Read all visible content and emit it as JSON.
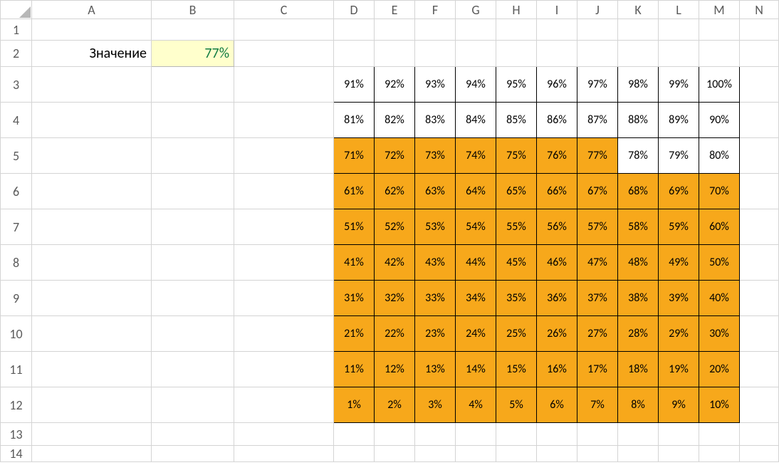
{
  "columns": [
    "A",
    "B",
    "C",
    "D",
    "E",
    "F",
    "G",
    "H",
    "I",
    "J",
    "K",
    "L",
    "M",
    "N"
  ],
  "rows": [
    "1",
    "2",
    "3",
    "4",
    "5",
    "6",
    "7",
    "8",
    "9",
    "10",
    "11",
    "12",
    "13",
    "14"
  ],
  "label": "Значение",
  "value": "77%",
  "threshold_pct": 77,
  "chart_data": {
    "type": "table",
    "title": "Percent grid with highlight ≤ value",
    "rows": [
      [
        "91%",
        "92%",
        "93%",
        "94%",
        "95%",
        "96%",
        "97%",
        "98%",
        "99%",
        "100%"
      ],
      [
        "81%",
        "82%",
        "83%",
        "84%",
        "85%",
        "86%",
        "87%",
        "88%",
        "89%",
        "90%"
      ],
      [
        "71%",
        "72%",
        "73%",
        "74%",
        "75%",
        "76%",
        "77%",
        "78%",
        "79%",
        "80%"
      ],
      [
        "61%",
        "62%",
        "63%",
        "64%",
        "65%",
        "66%",
        "67%",
        "68%",
        "69%",
        "70%"
      ],
      [
        "51%",
        "52%",
        "53%",
        "54%",
        "55%",
        "56%",
        "57%",
        "58%",
        "59%",
        "60%"
      ],
      [
        "41%",
        "42%",
        "43%",
        "44%",
        "45%",
        "46%",
        "47%",
        "48%",
        "49%",
        "50%"
      ],
      [
        "31%",
        "32%",
        "33%",
        "34%",
        "35%",
        "36%",
        "37%",
        "38%",
        "39%",
        "40%"
      ],
      [
        "21%",
        "22%",
        "23%",
        "24%",
        "25%",
        "26%",
        "27%",
        "28%",
        "29%",
        "30%"
      ],
      [
        "11%",
        "12%",
        "13%",
        "14%",
        "15%",
        "16%",
        "17%",
        "18%",
        "19%",
        "20%"
      ],
      [
        "1%",
        "2%",
        "3%",
        "4%",
        "5%",
        "6%",
        "7%",
        "8%",
        "9%",
        "10%"
      ]
    ]
  },
  "colors": {
    "fill": "#f7a81b",
    "value_bg": "#ffffcc",
    "value_fg": "#107c41"
  }
}
